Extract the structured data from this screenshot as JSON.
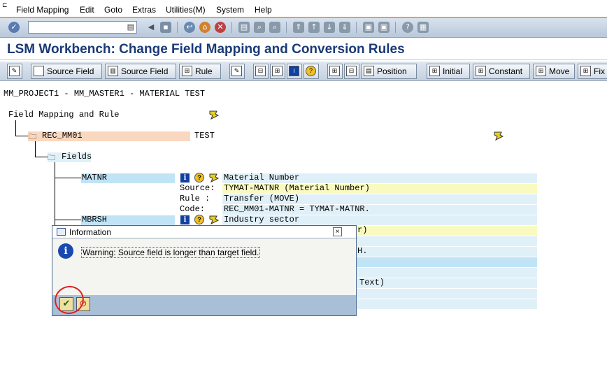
{
  "menubar": {
    "items": [
      "Field Mapping",
      "Edit",
      "Goto",
      "Extras",
      "Utilities(M)",
      "System",
      "Help"
    ]
  },
  "title": "LSM Workbench: Change Field Mapping and Conversion Rules",
  "app_toolbar": {
    "source_field_1": "Source Field",
    "source_field_2": "Source Field",
    "rule": "Rule",
    "position": "Position",
    "initial": "Initial",
    "constant": "Constant",
    "move": "Move",
    "fix": "Fix"
  },
  "tree": {
    "header": "MM_PROJECT1 - MM_MASTER1 - MATERIAL TEST",
    "root": "Field Mapping and Rule",
    "recording": "REC_MM01",
    "recording_desc": "TEST",
    "fields_node": "Fields",
    "field1": {
      "name": "MATNR",
      "desc": "Material Number",
      "source_label": "Source:",
      "source": "TYMAT-MATNR (Material Number)",
      "rule_label": "Rule :",
      "rule": "Transfer (MOVE)",
      "code_label": "Code:",
      "code": "REC_MM01-MATNR = TYMAT-MATNR."
    },
    "field2": {
      "name": "MBRSH",
      "desc": "Industry sector",
      "partial1": "r)",
      "partial2": "H.",
      "partial3": "Text)"
    }
  },
  "dialog": {
    "title": "Information",
    "message": "Warning: Source field is longer than target field.",
    "ok_icon": "check-icon",
    "help_icon": "help-icon"
  }
}
